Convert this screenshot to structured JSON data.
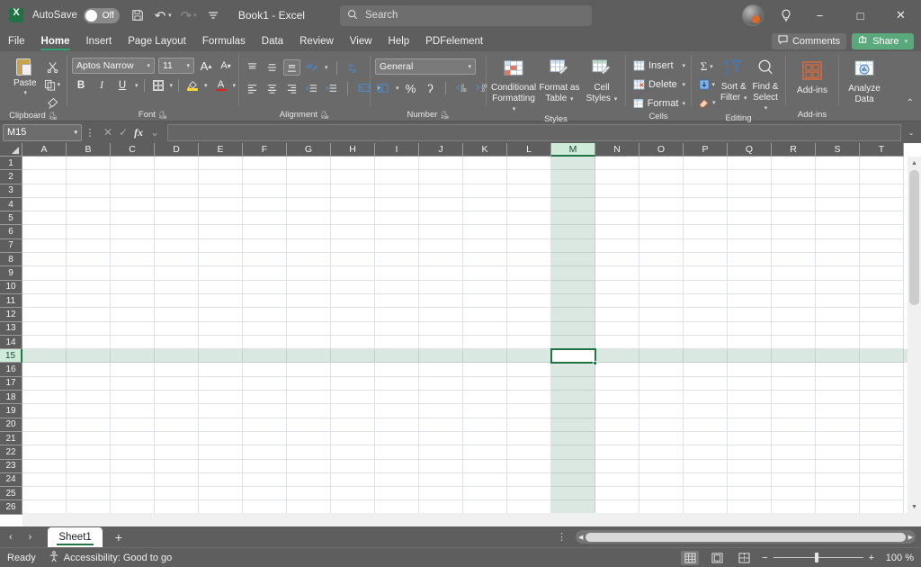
{
  "titlebar": {
    "logo_icon": "excel-logo-icon",
    "autosave_label": "AutoSave",
    "autosave_state": "Off",
    "save_icon": "save-icon",
    "undo_icon": "undo-icon",
    "redo_icon": "redo-icon",
    "customize_icon": "customize-quick-access-icon",
    "document_title": "Book1  -  Excel",
    "search_placeholder": "Search",
    "search_icon": "search-icon",
    "account_icon": "account-avatar-icon",
    "help_icon": "lightbulb-icon",
    "minimize": "−",
    "maximize": "□",
    "close": "✕"
  },
  "ribbon_tabs": [
    {
      "label": "File",
      "active": false
    },
    {
      "label": "Home",
      "active": true
    },
    {
      "label": "Insert",
      "active": false
    },
    {
      "label": "Page Layout",
      "active": false
    },
    {
      "label": "Formulas",
      "active": false
    },
    {
      "label": "Data",
      "active": false
    },
    {
      "label": "Review",
      "active": false
    },
    {
      "label": "View",
      "active": false
    },
    {
      "label": "Help",
      "active": false
    },
    {
      "label": "PDFelement",
      "active": false
    }
  ],
  "tabs_right": {
    "comments_label": "Comments",
    "comments_icon": "comment-bubble-icon",
    "share_label": "Share",
    "share_icon": "share-icon",
    "share_caret": "⌄"
  },
  "ribbon": {
    "clipboard": {
      "group_label": "Clipboard",
      "paste_label": "Paste",
      "paste_caret": "⌄",
      "cut_icon": "scissors-icon",
      "copy_icon": "copy-icon",
      "copy_caret": "⌄",
      "format_painter_icon": "format-painter-icon",
      "dialog_launcher": "⤵"
    },
    "font": {
      "group_label": "Font",
      "font_name": "Aptos Narrow",
      "font_size": "11",
      "grow_font": "A",
      "shrink_font": "A",
      "bold": "B",
      "italic": "I",
      "underline": "U",
      "underline_caret": "⌄",
      "borders_icon": "borders-icon",
      "borders_caret": "⌄",
      "fill_color_icon": "fill-color-icon",
      "fill_caret": "⌄",
      "font_color": "A",
      "font_color_caret": "⌄",
      "fill_color_hex": "#ffd43b",
      "font_color_hex": "#e02020",
      "dialog_launcher": "⤵"
    },
    "alignment": {
      "group_label": "Alignment",
      "align_top_icon": "align-top-icon",
      "align_middle_icon": "align-middle-icon",
      "align_bottom_icon": "align-bottom-icon",
      "orientation_icon": "text-orientation-icon",
      "orientation_caret": "⌄",
      "wrap_text_icon": "wrap-text-icon",
      "align_left_icon": "align-left-icon",
      "align_center_icon": "align-center-icon",
      "align_right_icon": "align-right-icon",
      "decrease_indent_icon": "decrease-indent-icon",
      "increase_indent_icon": "increase-indent-icon",
      "merge_center_icon": "merge-and-center-icon",
      "merge_caret": "⌄",
      "dialog_launcher": "⤵"
    },
    "number": {
      "group_label": "Number",
      "format": "General",
      "format_caret": "⌄",
      "accounting_icon": "accounting-format-icon",
      "accounting_caret": "⌄",
      "percent": "%",
      "comma": "ʔ",
      "increase_decimal_icon": "increase-decimal-icon",
      "decrease_decimal_icon": "decrease-decimal-icon",
      "dialog_launcher": "⤵"
    },
    "styles": {
      "group_label": "Styles",
      "conditional_formatting": "Conditional\nFormatting",
      "conditional_label_l1": "Conditional",
      "conditional_label_l2": "Formatting",
      "format_as_table_l1": "Format as",
      "format_as_table_l2": "Table",
      "cell_styles_l1": "Cell",
      "cell_styles_l2": "Styles",
      "caret": "⌄"
    },
    "cells": {
      "group_label": "Cells",
      "insert_label": "Insert",
      "delete_label": "Delete",
      "format_label": "Format",
      "caret": "⌄"
    },
    "editing": {
      "group_label": "Editing",
      "autosum_icon": "Σ",
      "fill_icon": "fill-down-icon",
      "clear_icon": "clear-eraser-icon",
      "sort_filter_l1": "Sort &",
      "sort_filter_l2": "Filter",
      "find_select_l1": "Find &",
      "find_select_l2": "Select",
      "caret": "⌄"
    },
    "addins": {
      "group_label": "Add-ins",
      "addins_label": "Add-ins",
      "analyze_l1": "Analyze",
      "analyze_l2": "Data"
    },
    "collapse_icon": "⌃"
  },
  "formula_bar": {
    "name_box_value": "M15",
    "name_box_caret": "⌄",
    "dots_icon": "⋮",
    "cancel_icon": "✕",
    "enter_icon": "✓",
    "fx_icon": "fx",
    "fx_caret": "⌄",
    "formula_value": "",
    "expand_icon": "⌄"
  },
  "grid": {
    "columns": [
      "A",
      "B",
      "C",
      "D",
      "E",
      "F",
      "G",
      "H",
      "I",
      "J",
      "K",
      "L",
      "M",
      "N",
      "O",
      "P",
      "Q",
      "R",
      "S",
      "T"
    ],
    "rows": [
      1,
      2,
      3,
      4,
      5,
      6,
      7,
      8,
      9,
      10,
      11,
      12,
      13,
      14,
      15,
      16,
      17,
      18,
      19,
      20,
      21,
      22,
      23,
      24,
      25,
      26
    ],
    "selected_cell": "M15",
    "selected_column": "M",
    "selected_row": 15,
    "selection_color": "#217346",
    "highlight_color": "#cdebd8",
    "scroll_up_icon": "▲",
    "scroll_down_icon": "▼"
  },
  "sheetbar": {
    "prev_icon": "‹",
    "next_icon": "›",
    "sheets": [
      {
        "name": "Sheet1",
        "active": true
      }
    ],
    "add_sheet_icon": "+",
    "options_icon": "⋮",
    "hscroll_left_icon": "◀",
    "hscroll_right_icon": "▶"
  },
  "statusbar": {
    "mode": "Ready",
    "accessibility_icon": "accessibility-icon",
    "accessibility_text": "Accessibility: Good to go",
    "view_normal_icon": "normal-view-icon",
    "view_page_layout_icon": "page-layout-view-icon",
    "view_page_break_icon": "page-break-preview-icon",
    "zoom_out": "−",
    "zoom_in": "+",
    "zoom_level": "100 %"
  }
}
